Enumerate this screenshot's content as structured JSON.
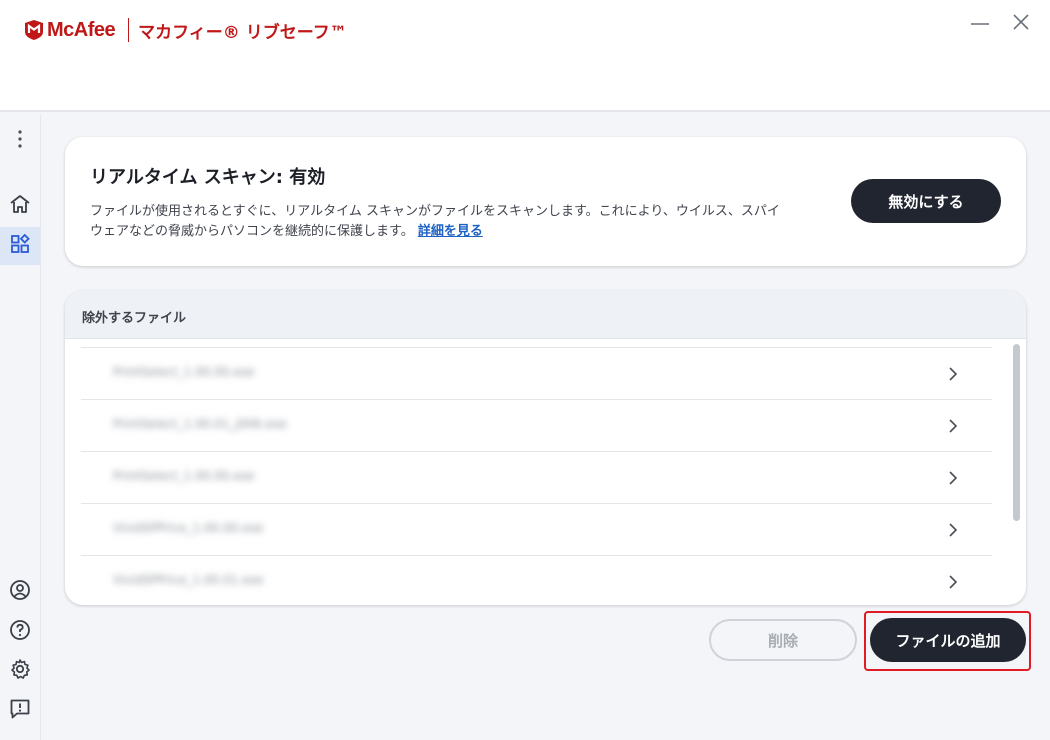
{
  "app": {
    "brand_name": "McAfee",
    "product_name": "マカフィー® リブセーフ™",
    "brand_color": "#c01818"
  },
  "window_controls": {
    "minimize_icon": "minimize-icon",
    "close_icon": "close-icon"
  },
  "sidebar": {
    "items": [
      {
        "name": "more-menu",
        "icon": "more-vertical-icon",
        "active": false
      },
      {
        "name": "home",
        "icon": "home-icon",
        "active": false
      },
      {
        "name": "apps",
        "icon": "apps-grid-icon",
        "active": true
      },
      {
        "name": "account",
        "icon": "account-icon",
        "active": false
      },
      {
        "name": "help",
        "icon": "help-icon",
        "active": false
      },
      {
        "name": "settings",
        "icon": "gear-icon",
        "active": false
      },
      {
        "name": "feedback",
        "icon": "feedback-icon",
        "active": false
      }
    ]
  },
  "realtime_scan": {
    "title": "リアルタイム スキャン: 有効",
    "description": "ファイルが使用されるとすぐに、リアルタイム スキャンがファイルをスキャンします。これにより、ウイルス、スパイウェアなどの脅威からパソコンを継続的に保護します。",
    "link_label": "詳細を見る",
    "disable_button": "無効にする"
  },
  "excluded_files": {
    "header": "除外するファイル",
    "files": [
      {
        "name": "PrintSelect_1.00.00.exe"
      },
      {
        "name": "PrintSelect_1.00.01_j006.exe"
      },
      {
        "name": "PrintSelect_1.00.00.exe"
      },
      {
        "name": "VividSPPrice_1.00.00.exe"
      },
      {
        "name": "VividSPPrice_1.00.01.exe"
      }
    ]
  },
  "actions": {
    "delete_label": "削除",
    "add_file_label": "ファイルの追加"
  },
  "colors": {
    "accent_dark": "#20252f",
    "highlight": "#e01b24",
    "link": "#1d62c4"
  }
}
